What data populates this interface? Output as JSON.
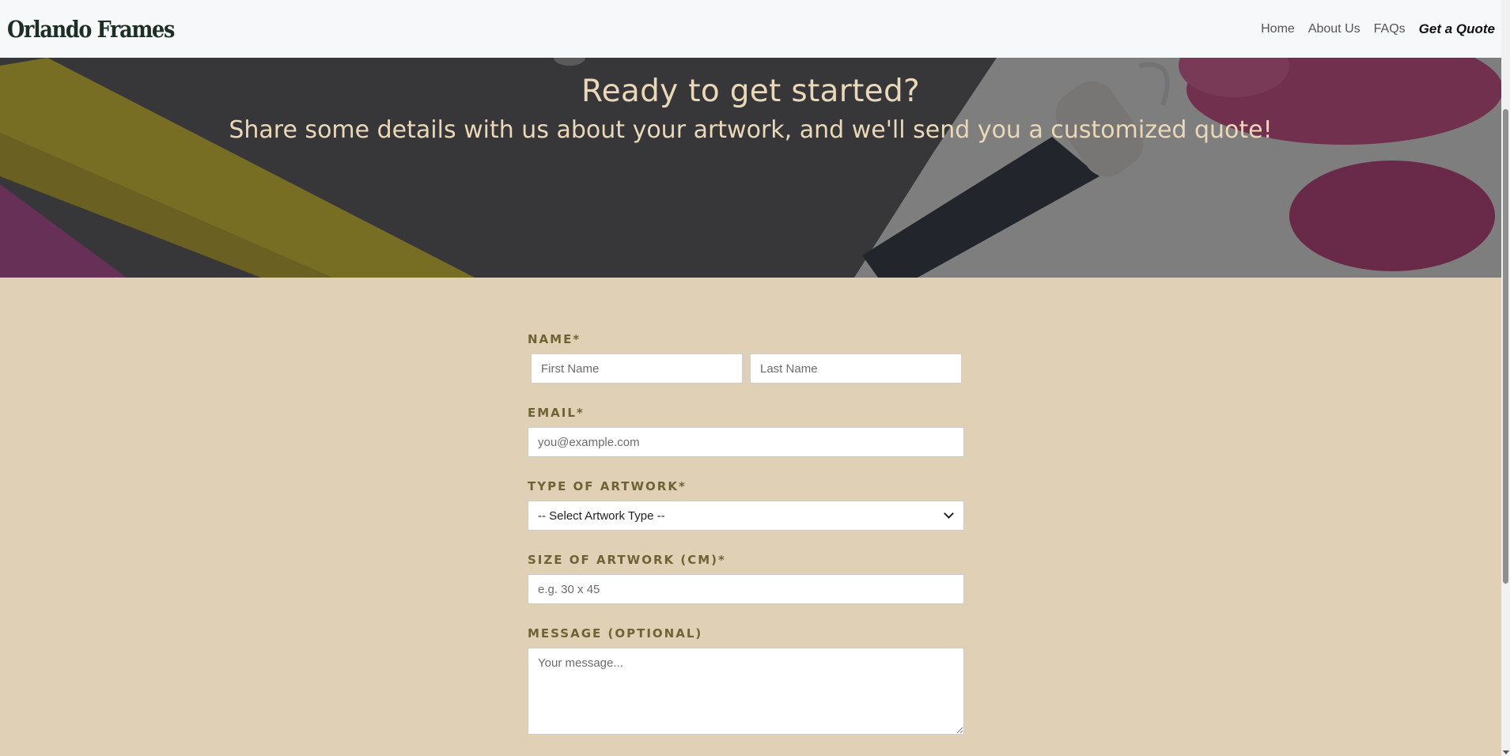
{
  "header": {
    "logo": "Orlando Frames",
    "nav": {
      "home": "Home",
      "about": "About Us",
      "faqs": "FAQs",
      "quote": "Get a Quote"
    }
  },
  "hero": {
    "title": "Ready to get started?",
    "subtitle": "Share some details with us about your artwork, and we'll send you a customized quote!"
  },
  "form": {
    "name": {
      "label": "NAME*",
      "first_placeholder": "First Name",
      "last_placeholder": "Last Name"
    },
    "email": {
      "label": "EMAIL*",
      "placeholder": "you@example.com"
    },
    "artwork_type": {
      "label": "TYPE OF ARTWORK*",
      "selected": "-- Select Artwork Type --"
    },
    "size": {
      "label": "SIZE OF ARTWORK (CM)*",
      "placeholder": "e.g. 30 x 45"
    },
    "message": {
      "label": "MESSAGE (OPTIONAL)",
      "placeholder": "Your message..."
    }
  },
  "colors": {
    "header_bg": "#f7f8f9",
    "page_bg": "#e0d0b5",
    "hero_text": "#ead8b7",
    "label_text": "#6d6434"
  },
  "icons": {
    "select_arrow": "chevron-down-icon"
  }
}
